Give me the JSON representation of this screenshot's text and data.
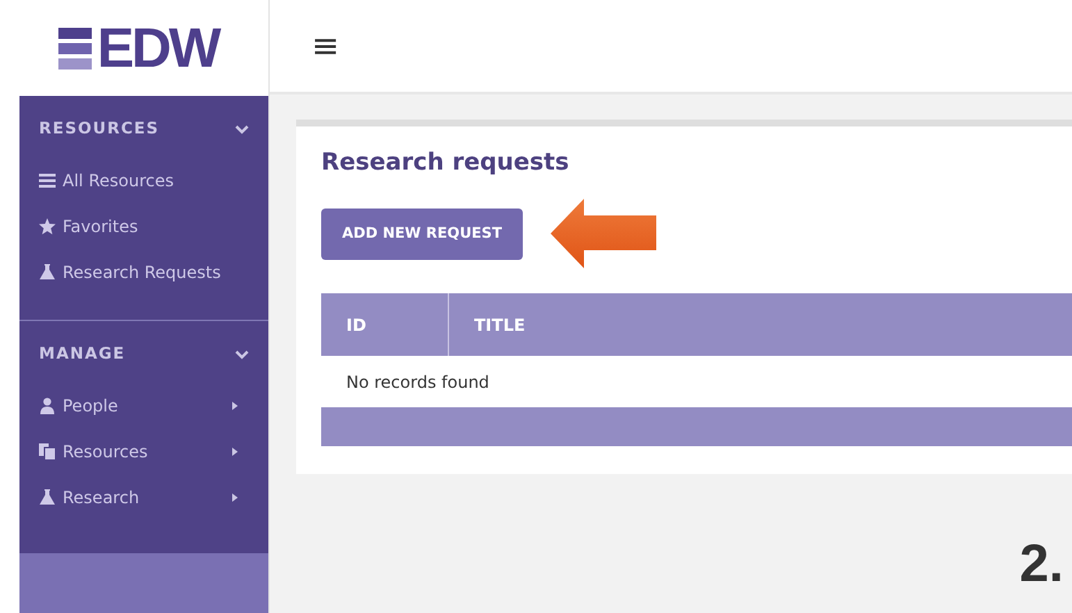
{
  "logo": {
    "text": "EDW"
  },
  "sidebar": {
    "sections": [
      {
        "title": "RESOURCES",
        "expanded": true,
        "items": [
          {
            "label": "All Resources",
            "submenu": false
          },
          {
            "label": "Favorites",
            "submenu": false
          },
          {
            "label": "Research Requests",
            "submenu": false
          }
        ]
      },
      {
        "title": "MANAGE",
        "expanded": true,
        "items": [
          {
            "label": "People",
            "submenu": true
          },
          {
            "label": "Resources",
            "submenu": true
          },
          {
            "label": "Research",
            "submenu": true
          }
        ]
      }
    ]
  },
  "topbar": {
    "menu_icon": "≡"
  },
  "panel": {
    "title": "Research requests",
    "button": "ADD NEW REQUEST",
    "table": {
      "columns": [
        "ID",
        "TITLE"
      ],
      "empty_message": "No records found"
    }
  },
  "step_label": "2."
}
